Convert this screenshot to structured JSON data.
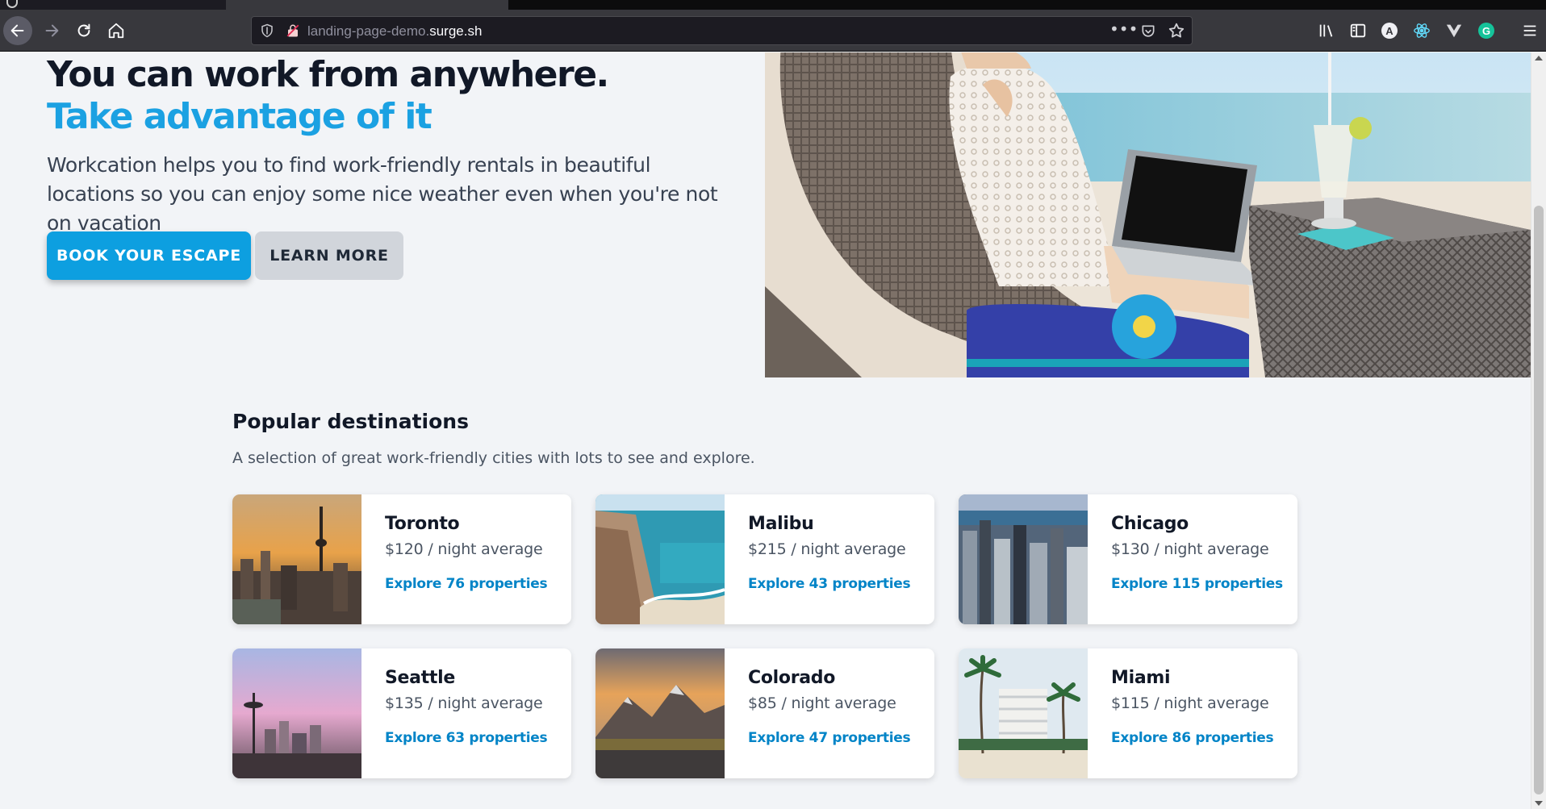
{
  "browser": {
    "url_prefix": "landing-page-demo.",
    "url_domain": "surge.sh",
    "more_label": "•••",
    "extension_a_label": "A",
    "extension_g_label": "G"
  },
  "hero": {
    "title_line1": "You can work from anywhere.",
    "title_line2": "Take advantage of it",
    "description": "Workcation helps you to find work-friendly rentals in beautiful locations so you can enjoy some nice weather even when you're not on vacation",
    "primary_button": "Book your escape",
    "secondary_button": "Learn more",
    "accent_color": "#1ba1e2"
  },
  "destinations": {
    "title": "Popular destinations",
    "subtitle": "A selection of great work-friendly cities with lots to see and explore.",
    "cards": [
      {
        "city": "Toronto",
        "price": "$120 / night average",
        "link": "Explore 76 properties"
      },
      {
        "city": "Malibu",
        "price": "$215 / night average",
        "link": "Explore 43 properties"
      },
      {
        "city": "Chicago",
        "price": "$130 / night average",
        "link": "Explore 115 properties"
      },
      {
        "city": "Seattle",
        "price": "$135 / night average",
        "link": "Explore 63 properties"
      },
      {
        "city": "Colorado",
        "price": "$85 / night average",
        "link": "Explore 47 properties"
      },
      {
        "city": "Miami",
        "price": "$115 / night average",
        "link": "Explore 86 properties"
      }
    ]
  }
}
